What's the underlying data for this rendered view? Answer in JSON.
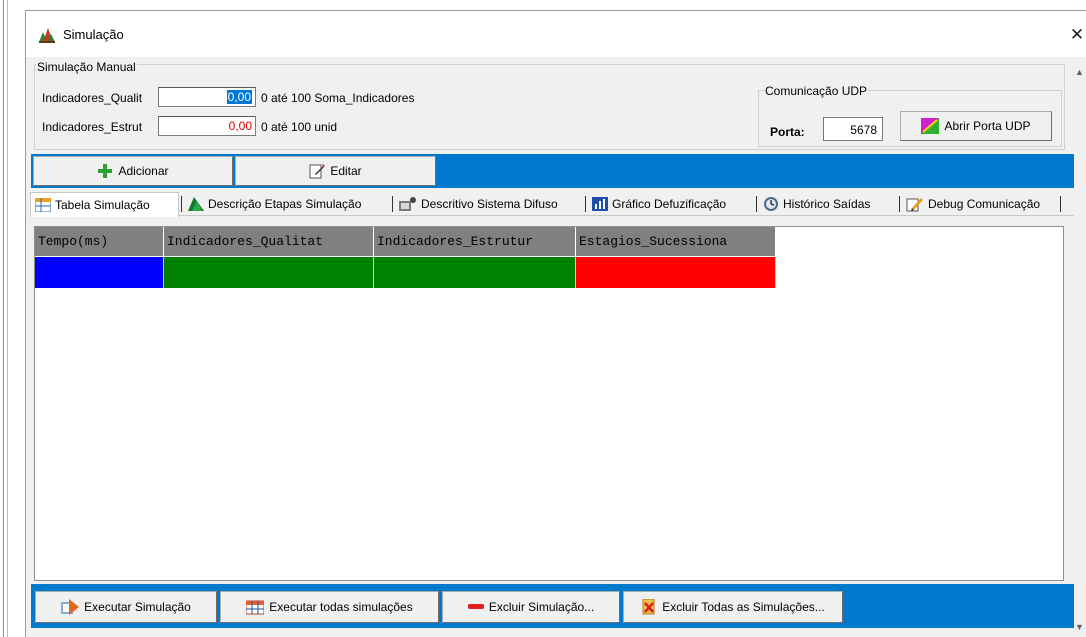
{
  "window": {
    "title": "Simulação",
    "close_glyph": "✕"
  },
  "manual": {
    "legend": "Simulação Manual",
    "rows": [
      {
        "label": "Indicadores_Qualit",
        "value": "0,00",
        "desc": "0 até 100 Soma_Indicadores"
      },
      {
        "label": "Indicadores_Estrut",
        "value": "0,00",
        "desc": "0 até 100 unid"
      }
    ]
  },
  "udp": {
    "legend": "Comunicação UDP",
    "port_label": "Porta:",
    "port_value": "5678",
    "open_button": "Abrir Porta UDP"
  },
  "toolbar": {
    "add_label": "Adicionar",
    "edit_label": "Editar"
  },
  "tabs": [
    {
      "label": "Tabela Simulação",
      "icon": "table-icon"
    },
    {
      "label": "Descrição Etapas Simulação",
      "icon": "steps-icon"
    },
    {
      "label": "Descritivo Sistema Difuso",
      "icon": "fuzzy-icon"
    },
    {
      "label": "Gráfico Defuzificação",
      "icon": "chart-icon"
    },
    {
      "label": "Histórico Saídas",
      "icon": "history-icon"
    },
    {
      "label": "Debug Comunicação",
      "icon": "debug-icon"
    }
  ],
  "grid": {
    "columns": [
      "Tempo(ms)",
      "Indicadores_Qualitat",
      "Indicadores_Estrutur",
      "Estagios_Sucessiona"
    ],
    "row_colors": [
      "#0000ff",
      "#008000",
      "#008000",
      "#ff0000"
    ]
  },
  "actions": {
    "execute": "Executar Simulação",
    "execute_all": "Executar todas simulações",
    "delete": "Excluir Simulação...",
    "delete_all": "Excluir Todas as Simulações..."
  },
  "colors": {
    "toolbar_bg": "#007acc",
    "header_bg": "#808080"
  }
}
